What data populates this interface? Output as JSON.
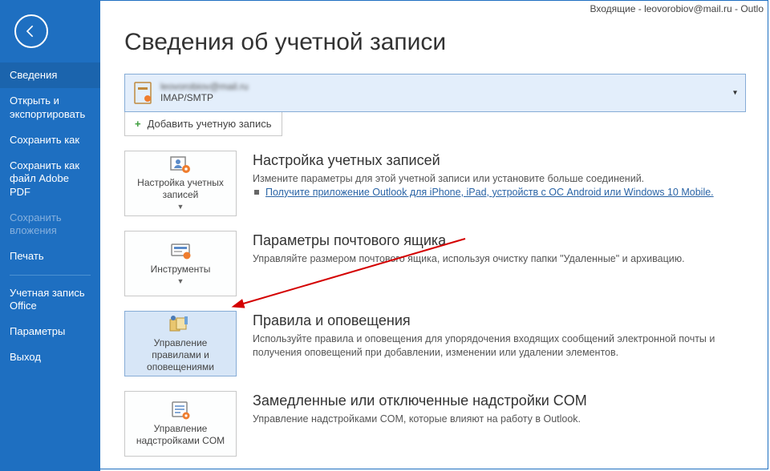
{
  "titlebar": "Входящие - leovorobiov@mail.ru  -  Outlo",
  "sidebar": {
    "items": [
      {
        "label": "Сведения",
        "active": true
      },
      {
        "label": "Открыть и экспортировать"
      },
      {
        "label": "Сохранить как"
      },
      {
        "label": "Сохранить как файл Adobe PDF"
      },
      {
        "label": "Сохранить вложения",
        "disabled": true
      },
      {
        "label": "Печать"
      }
    ],
    "items2": [
      {
        "label": "Учетная запись Office"
      },
      {
        "label": "Параметры"
      },
      {
        "label": "Выход"
      }
    ]
  },
  "page": {
    "title": "Сведения об учетной записи",
    "account": {
      "email": "leovorobiov@mail.ru",
      "protocol": "IMAP/SMTP"
    },
    "addAccount": "Добавить учетную запись",
    "sections": [
      {
        "tile": "Настройка учетных записей",
        "tileHasCaret": true,
        "title": "Настройка учетных записей",
        "desc": "Измените параметры для этой учетной записи или установите больше соединений.",
        "link": "Получите приложение Outlook для iPhone, iPad, устройств с ОС Android или Windows 10 Mobile."
      },
      {
        "tile": "Инструменты",
        "tileHasCaret": true,
        "title": "Параметры почтового ящика",
        "desc": "Управляйте размером почтового ящика, используя очистку папки \"Удаленные\" и архивацию."
      },
      {
        "tile": "Управление правилами и оповещениями",
        "selected": true,
        "title": "Правила и оповещения",
        "desc": "Используйте правила и оповещения для упорядочения входящих сообщений электронной почты и получения оповещений при добавлении, изменении или удалении элементов."
      },
      {
        "tile": "Управление надстройками COM",
        "title": "Замедленные или отключенные надстройки COM",
        "desc": "Управление надстройками COM, которые влияют на работу в Outlook."
      }
    ]
  }
}
